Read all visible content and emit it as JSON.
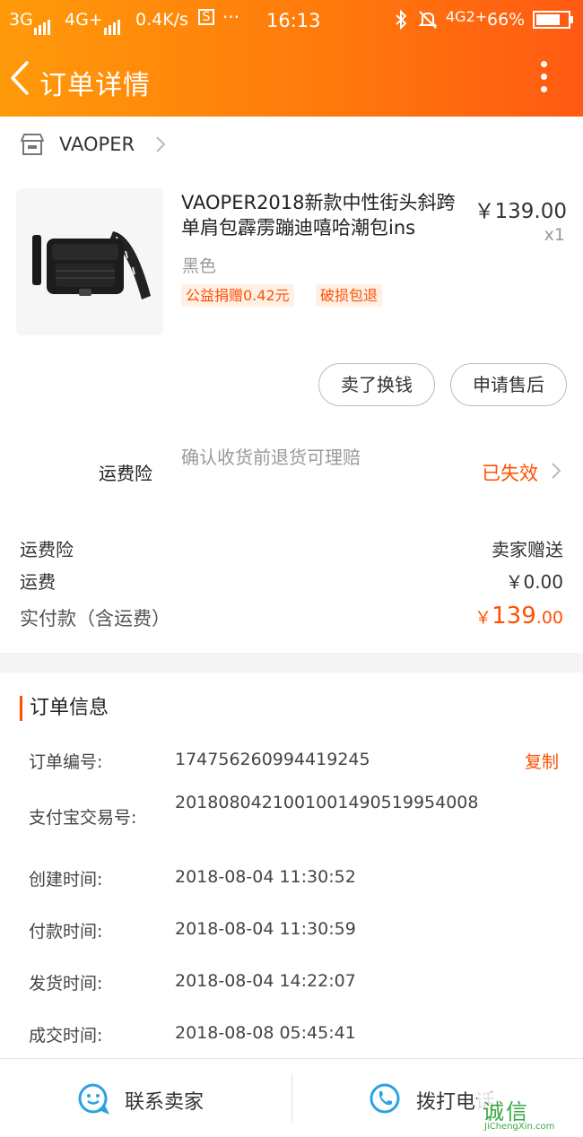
{
  "status_bar": {
    "network1": "3G",
    "network2": "4G+",
    "speed": "0.4K/s",
    "dots": "···",
    "time": "16:13",
    "network3": "4G2+",
    "battery": "66%"
  },
  "nav": {
    "title": "订单详情",
    "back_icon": "chevron-left-icon",
    "more_icon": "more-vertical-icon"
  },
  "shop": {
    "name": "VAOPER",
    "icon": "store-icon"
  },
  "product": {
    "title": "VAOPER2018新款中性街头斜跨单肩包霹雳蹦迪嘻哈潮包ins",
    "price": "￥139.00",
    "qty": "x1",
    "variant": "黑色",
    "tags": [
      "公益捐赠0.42元",
      "破损包退"
    ]
  },
  "actions": {
    "sell_label": "卖了换钱",
    "aftersale_label": "申请售后"
  },
  "insurance": {
    "label": "运费险",
    "desc": "确认收货前退货可理赔",
    "status": "已失效"
  },
  "fees": {
    "ins_label": "运费险",
    "ins_value": "卖家赠送",
    "shipping_label": "运费",
    "shipping_value": "￥0.00",
    "total_label": "实付款（含运费）",
    "total_currency": "￥",
    "total_int": "139",
    "total_dec": ".00"
  },
  "order_info": {
    "title": "订单信息",
    "copy_label": "复制",
    "rows": [
      {
        "label": "订单编号:",
        "value": "174756260994419245"
      },
      {
        "label": "支付宝交易号:",
        "value": "2018080421001001490519954008"
      },
      {
        "label": "创建时间:",
        "value": "2018-08-04 11:30:52"
      },
      {
        "label": "付款时间:",
        "value": "2018-08-04 11:30:59"
      },
      {
        "label": "发货时间:",
        "value": "2018-08-04 14:22:07"
      },
      {
        "label": "成交时间:",
        "value": "2018-08-08 05:45:41"
      }
    ]
  },
  "bottom_bar": {
    "contact_label": "联系卖家",
    "call_label": "拨打电话"
  },
  "watermark": {
    "main": "诚信",
    "sub": "JiChengXin.com"
  },
  "colors": {
    "accent": "#ff5000",
    "nav_gradient_start": "#ff9a0a",
    "nav_gradient_end": "#ff5a12",
    "icon_blue": "#2aa3e3"
  }
}
